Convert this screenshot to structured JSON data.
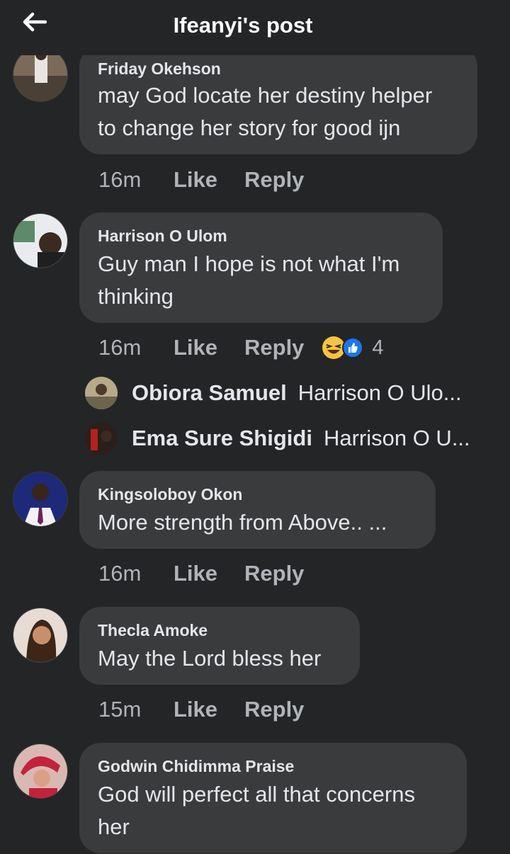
{
  "header": {
    "title": "Ifeanyi's post"
  },
  "comments": [
    {
      "author": "Friday Okehson",
      "text": "may God locate her destiny helper\nto change her story for good ijn",
      "time": "16m",
      "like_label": "Like",
      "reply_label": "Reply"
    },
    {
      "author": "Harrison O Ulom",
      "text": "Guy man I hope is not what I'm\nthinking",
      "time": "16m",
      "like_label": "Like",
      "reply_label": "Reply",
      "reaction_count": "4",
      "replies": [
        {
          "name": "Obiora Samuel",
          "snippet": "Harrison O Ulo..."
        },
        {
          "name": "Ema Sure Shigidi",
          "snippet": "Harrison O U..."
        }
      ]
    },
    {
      "author": "Kingsoloboy Okon",
      "text": "More strength from Above.. ...",
      "time": "16m",
      "like_label": "Like",
      "reply_label": "Reply"
    },
    {
      "author": "Thecla Amoke",
      "text": "May the Lord bless her",
      "time": "15m",
      "like_label": "Like",
      "reply_label": "Reply"
    },
    {
      "author": "Godwin Chidimma Praise",
      "text": "God will perfect all that concerns\nher"
    }
  ],
  "colors": {
    "background": "#242527",
    "bubble": "#3a3b3c",
    "primary_text": "#e4e6eb",
    "secondary_text": "#b0b3b8",
    "like_blue": "#1877f2",
    "haha_yellow": "#f7c53c"
  }
}
